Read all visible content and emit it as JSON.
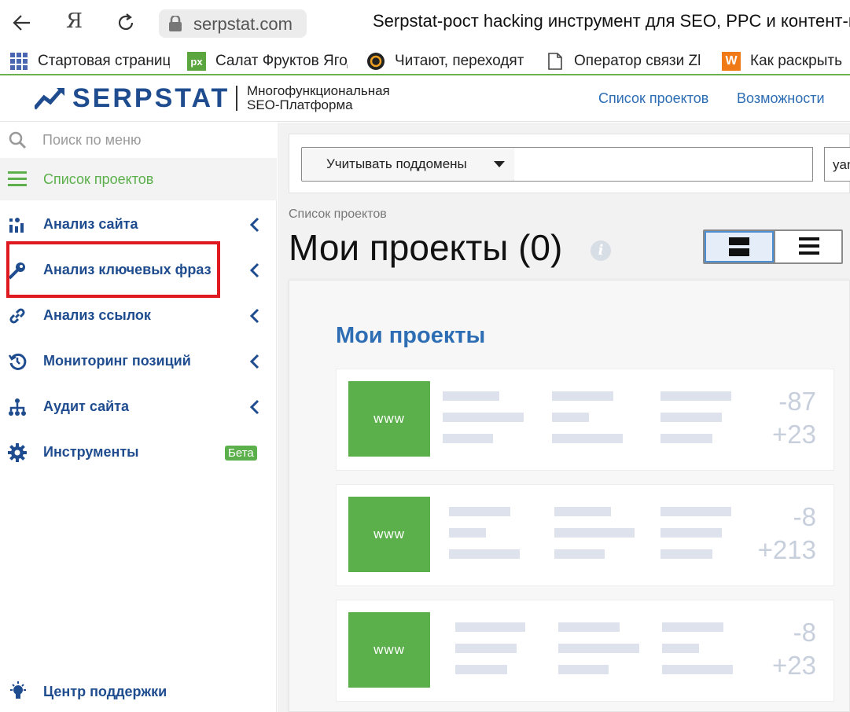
{
  "browser": {
    "back_icon": "arrow-left-icon",
    "yandex_label": "Я",
    "url": "serpstat.com",
    "tab_title": "Serpstat-рост hacking инструмент для SEO, PPC и контент-маркетинга"
  },
  "bookmarks": [
    {
      "icon": "grid-icon",
      "label": "Стартовая страница"
    },
    {
      "icon": "px-icon",
      "label": "Салат Фруктов Ягод"
    },
    {
      "icon": "circle-logo-icon",
      "label": "Читают, переходят"
    },
    {
      "icon": "document-icon",
      "label": "Оператор связи Zl"
    },
    {
      "icon": "w-logo-icon",
      "label": "Как раскрыть"
    }
  ],
  "header": {
    "logo_text": "SERPSTAT",
    "tagline_line1": "Многофункциональная",
    "tagline_line2": "SEO-Платформа",
    "nav": [
      "Список проектов",
      "Возможности"
    ]
  },
  "sidebar": {
    "search_placeholder": "Поиск по меню",
    "projects_label": "Список проектов",
    "items": [
      {
        "label": "Анализ сайта"
      },
      {
        "label": "Анализ ключевых фраз"
      },
      {
        "label": "Анализ ссылок"
      },
      {
        "label": "Мониторинг позиций"
      },
      {
        "label": "Аудит сайта"
      },
      {
        "label": "Инструменты",
        "badge": "Бета"
      }
    ],
    "support_label": "Центр поддержки"
  },
  "main": {
    "subdomains_label": "Учитывать поддомены",
    "domain_input_value": "",
    "db_select_value": "yandex",
    "breadcrumb": "Список проектов",
    "title": "Мои проекты (0)",
    "info_glyph": "i",
    "panel_title": "Мои проекты",
    "cards": [
      {
        "logo": "www",
        "num1": "-87",
        "num2": "+23"
      },
      {
        "logo": "www",
        "num1": "-8",
        "num2": "+213"
      },
      {
        "logo": "www",
        "num1": "-8",
        "num2": "+23"
      }
    ]
  },
  "colors": {
    "brand_blue": "#1e4c8f",
    "link_blue": "#2d6db4",
    "green": "#5bb04b",
    "highlight_red": "#e0181f"
  }
}
